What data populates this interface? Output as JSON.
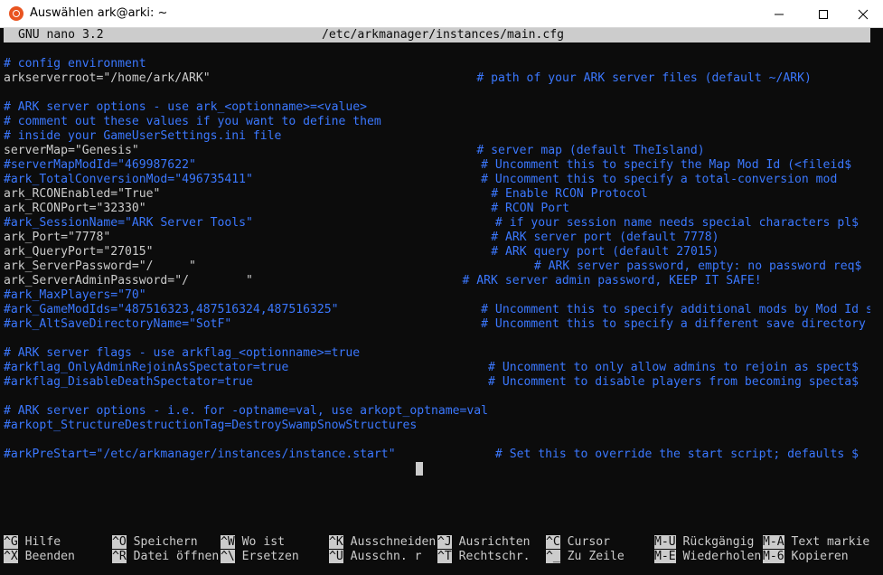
{
  "window": {
    "title": "Auswählen ark@arki: ~",
    "colors": {
      "background": "#0c0c0c",
      "text": "#cccccc",
      "comment": "#3b78ff",
      "titlebar": "#ffffff"
    }
  },
  "nano": {
    "version": "GNU nano 3.2",
    "filename": "/etc/arkmanager/instances/main.cfg"
  },
  "lines": [
    {
      "setting": "",
      "comment": "# config environment",
      "col": 0
    },
    {
      "setting": "arkserverroot=\"/home/ark/ARK\"",
      "comment": "# path of your ARK server files (default ~/ARK)",
      "col": 66
    },
    {
      "setting": "",
      "comment": "",
      "col": 0
    },
    {
      "setting": "",
      "comment": "# ARK server options - use ark_<optionname>=<value>",
      "col": 0
    },
    {
      "setting": "",
      "comment": "# comment out these values if you want to define them",
      "col": 0
    },
    {
      "setting": "",
      "comment": "# inside your GameUserSettings.ini file",
      "col": 0
    },
    {
      "setting": "serverMap=\"Genesis\"",
      "comment": "# server map (default TheIsland)",
      "col": 66
    },
    {
      "setting": "",
      "comment": "#serverMapModId=\"469987622\"                                        # Uncomment this to specify the Map Mod Id (<fileid$",
      "col": 0
    },
    {
      "setting": "",
      "comment": "#ark_TotalConversionMod=\"496735411\"                                # Uncomment this to specify a total-conversion mod",
      "col": 0
    },
    {
      "setting": "ark_RCONEnabled=\"True\"",
      "comment": "# Enable RCON Protocol",
      "col": 68
    },
    {
      "setting": "ark_RCONPort=\"32330\"",
      "comment": "# RCON Port",
      "col": 68
    },
    {
      "setting": "",
      "comment": "#ark_SessionName=\"ARK Server Tools\"                                  # if your session name needs special characters pl$",
      "col": 0
    },
    {
      "setting": "ark_Port=\"7778\"",
      "comment": "# ARK server port (default 7778)",
      "col": 68
    },
    {
      "setting": "ark_QueryPort=\"27015\"",
      "comment": "# ARK query port (default 27015)",
      "col": 68
    },
    {
      "setting": "ark_ServerPassword=\"/     \"",
      "comment": "# ARK server password, empty: no password req$",
      "col": 74
    },
    {
      "setting": "ark_ServerAdminPassword=\"/        \"",
      "comment": "# ARK server admin password, KEEP IT SAFE!",
      "col": 64
    },
    {
      "setting": "",
      "comment": "#ark_MaxPlayers=\"70\"",
      "col": 0
    },
    {
      "setting": "",
      "comment": "#ark_GameModIds=\"487516323,487516324,487516325\"                    # Uncomment this to specify additional mods by Mod Id se$",
      "col": 0
    },
    {
      "setting": "",
      "comment": "#ark_AltSaveDirectoryName=\"SotF\"                                   # Uncomment this to specify a different save directory n$",
      "col": 0
    },
    {
      "setting": "",
      "comment": "",
      "col": 0
    },
    {
      "setting": "",
      "comment": "# ARK server flags - use arkflag_<optionname>=true",
      "col": 0
    },
    {
      "setting": "",
      "comment": "#arkflag_OnlyAdminRejoinAsSpectator=true                            # Uncomment to only allow admins to rejoin as spect$",
      "col": 0
    },
    {
      "setting": "",
      "comment": "#arkflag_DisableDeathSpectator=true                                 # Uncomment to disable players from becoming specta$",
      "col": 0
    },
    {
      "setting": "",
      "comment": "",
      "col": 0
    },
    {
      "setting": "",
      "comment": "# ARK server options - i.e. for -optname=val, use arkopt_optname=val",
      "col": 0
    },
    {
      "setting": "",
      "comment": "#arkopt_StructureDestructionTag=DestroySwampSnowStructures",
      "col": 0
    },
    {
      "setting": "",
      "comment": "",
      "col": 0
    },
    {
      "setting": "",
      "comment": "#arkPreStart=\"/etc/arkmanager/instances/instance.start\"              # Set this to override the start script; defaults $",
      "col": 0
    }
  ],
  "shortcuts_row1": [
    {
      "key": "^G",
      "label": "Hilfe"
    },
    {
      "key": "^O",
      "label": "Speichern"
    },
    {
      "key": "^W",
      "label": "Wo ist"
    },
    {
      "key": "^K",
      "label": "Ausschneiden"
    },
    {
      "key": "^J",
      "label": "Ausrichten"
    },
    {
      "key": "^C",
      "label": "Cursor"
    },
    {
      "key": "M-U",
      "label": "Rückgängig"
    },
    {
      "key": "M-A",
      "label": "Text markie"
    }
  ],
  "shortcuts_row2": [
    {
      "key": "^X",
      "label": "Beenden"
    },
    {
      "key": "^R",
      "label": "Datei öffnen"
    },
    {
      "key": "^\\",
      "label": "Ersetzen"
    },
    {
      "key": "^U",
      "label": "Ausschn. r"
    },
    {
      "key": "^T",
      "label": "Rechtschr."
    },
    {
      "key": "^_",
      "label": "Zu Zeile"
    },
    {
      "key": "M-E",
      "label": "Wiederholen"
    },
    {
      "key": "M-6",
      "label": "Kopieren"
    }
  ]
}
